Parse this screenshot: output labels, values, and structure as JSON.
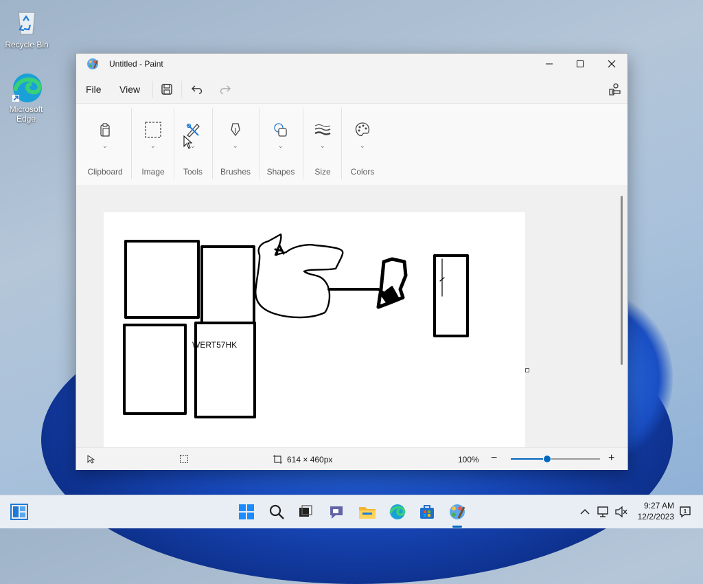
{
  "desktop": {
    "icons": [
      {
        "label": "Recycle Bin"
      },
      {
        "label": "Microsoft\nEdge"
      }
    ]
  },
  "window": {
    "title": "Untitled - Paint",
    "controls": {
      "minimize": "—",
      "maximize": "□",
      "close": "✕"
    },
    "menu": {
      "file": "File",
      "view": "View"
    }
  },
  "ribbon": {
    "groups": [
      {
        "label": "Clipboard",
        "icon": "clipboard-icon"
      },
      {
        "label": "Image",
        "icon": "selection-icon"
      },
      {
        "label": "Tools",
        "icon": "tools-icon"
      },
      {
        "label": "Brushes",
        "icon": "brush-icon"
      },
      {
        "label": "Shapes",
        "icon": "shapes-icon"
      },
      {
        "label": "Size",
        "icon": "size-icon"
      },
      {
        "label": "Colors",
        "icon": "palette-icon"
      }
    ]
  },
  "canvas": {
    "text": "WERT57HK"
  },
  "status": {
    "canvas_size": "614 × 460px",
    "zoom": "100%",
    "zoom_level_fraction": 0.4
  },
  "taskbar": {
    "time": "9:27 AM",
    "date": "12/2/2023"
  },
  "colors": {
    "accent": "#0067c0",
    "window_bg": "#f3f3f3",
    "ribbon_bg": "#f9f9f9"
  }
}
